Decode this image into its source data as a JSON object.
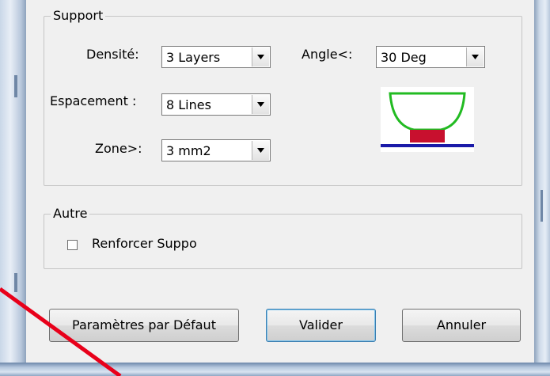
{
  "support": {
    "title": "Support",
    "density_label": "Densité:",
    "density_value": "3 Layers",
    "spacing_label": "Espacement :",
    "spacing_value": "8 Lines",
    "zone_label": "Zone>:",
    "zone_value": "3 mm2",
    "angle_label": "Angle<:",
    "angle_value": "30 Deg"
  },
  "other": {
    "title": "Autre",
    "reinforce_label": "Renforcer Suppo",
    "reinforce_checked": false
  },
  "buttons": {
    "defaults": "Paramètres par Défaut",
    "ok": "Valider",
    "cancel": "Annuler"
  },
  "colors": {
    "frame_accent": "#c9494e",
    "illustration_bowl": "#22bb22",
    "illustration_support": "#c8102e",
    "illustration_base": "#1a1aa8",
    "annotation_line": "#e8001a"
  },
  "icons": {
    "combo_arrow": "chevron-down-icon",
    "illustration": "support-diagram"
  }
}
